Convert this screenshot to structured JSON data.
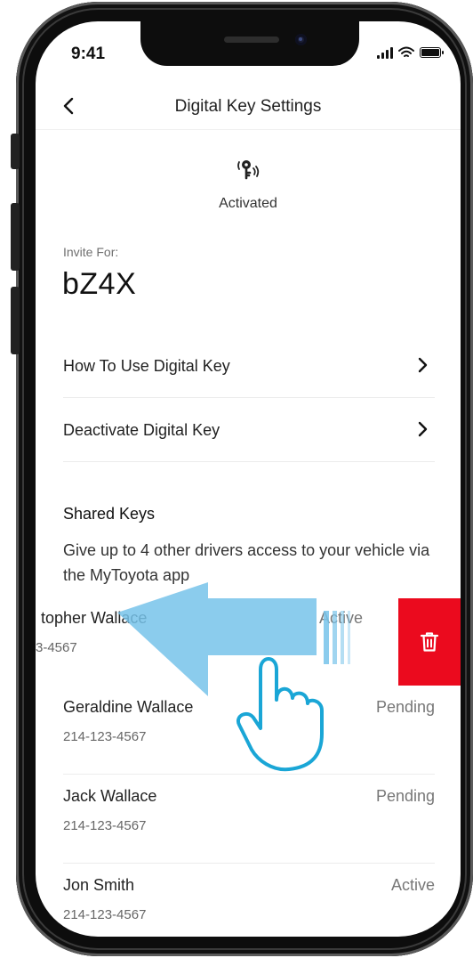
{
  "status_bar": {
    "time": "9:41"
  },
  "header": {
    "title": "Digital Key Settings"
  },
  "key_status": {
    "label": "Activated"
  },
  "vehicle": {
    "invite_label": "Invite For:",
    "name": "bZ4X"
  },
  "menu": [
    {
      "label": "How To Use Digital Key"
    },
    {
      "label": "Deactivate Digital Key"
    }
  ],
  "shared_keys": {
    "title": "Shared Keys",
    "description": "Give up to 4 other drivers access to your vehicle via the MyToyota app",
    "swiped_contact": {
      "name": "topher Wallace",
      "phone": "3-4567",
      "status": "Active"
    },
    "contacts": [
      {
        "name": "Geraldine Wallace",
        "phone": "214-123-4567",
        "status": "Pending"
      },
      {
        "name": "Jack Wallace",
        "phone": "214-123-4567",
        "status": "Pending"
      },
      {
        "name": "Jon Smith",
        "phone": "214-123-4567",
        "status": "Active"
      }
    ]
  },
  "icons": {
    "back": "chevron-left-icon",
    "row_chevron": "chevron-right-icon",
    "key": "digital-key-icon",
    "delete": "trash-icon",
    "gesture": "hand-pointer-icon",
    "gesture_arrow": "arrow-left-icon"
  },
  "colors": {
    "delete_red": "#eb0a1e",
    "swipe_blue": "#77c3ea"
  }
}
